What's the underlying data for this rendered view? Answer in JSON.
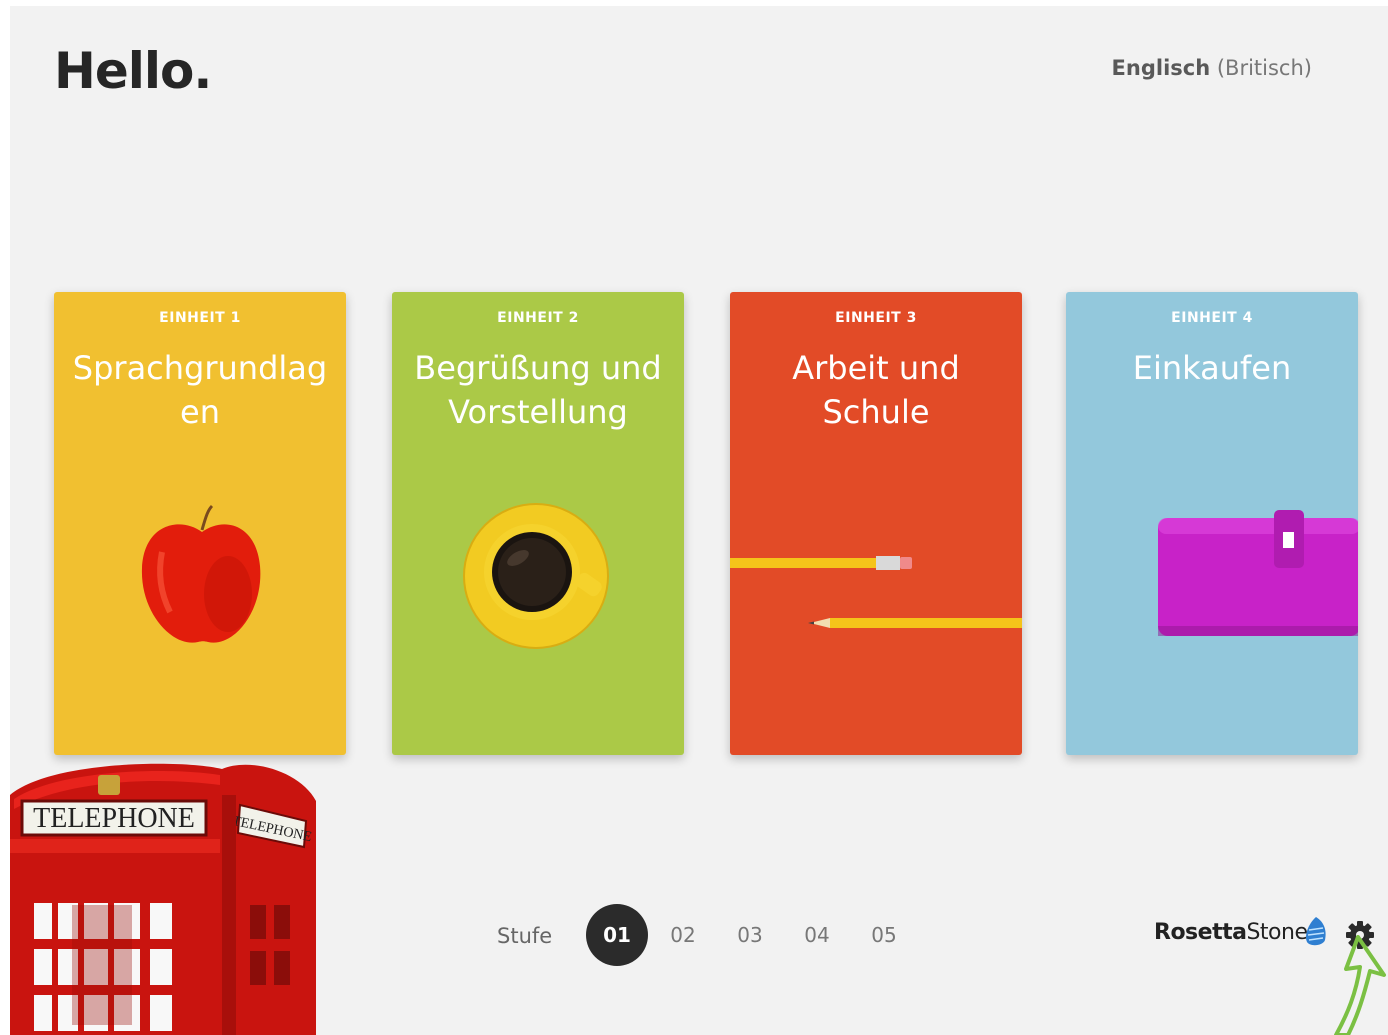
{
  "header": {
    "greeting": "Hello.",
    "language_name": "Englisch",
    "language_variant": "(Britisch)"
  },
  "units": [
    {
      "label": "EINHEIT 1",
      "title_lines": [
        "Sprachgrundlag",
        "en"
      ],
      "color": "#f1c030",
      "image": "apple-icon"
    },
    {
      "label": "EINHEIT 2",
      "title_lines": [
        "Begrüßung und",
        "Vorstellung"
      ],
      "color": "#abc947",
      "image": "coffee-cup-icon"
    },
    {
      "label": "EINHEIT 3",
      "title_lines": [
        "Arbeit und",
        "Schule"
      ],
      "color": "#e24b27",
      "image": "pencils-icon"
    },
    {
      "label": "EINHEIT 4",
      "title_lines": [
        "Einkaufen"
      ],
      "color": "#93c8dc",
      "image": "wallet-icon"
    }
  ],
  "levels": {
    "label": "Stufe",
    "items": [
      "01",
      "02",
      "03",
      "04",
      "05"
    ],
    "active": "01"
  },
  "footer": {
    "brand_bold": "Rosetta",
    "brand_light": "Stone",
    "settings_icon": "gear-icon"
  },
  "decor": {
    "booth_sign": "TELEPHONE",
    "booth_side_sign": "TELEPHONE"
  },
  "colors": {
    "background": "#f2f2f2",
    "active_level": "#2b2b2b",
    "booth_red": "#d31616",
    "cursor_green": "#7bc043"
  }
}
